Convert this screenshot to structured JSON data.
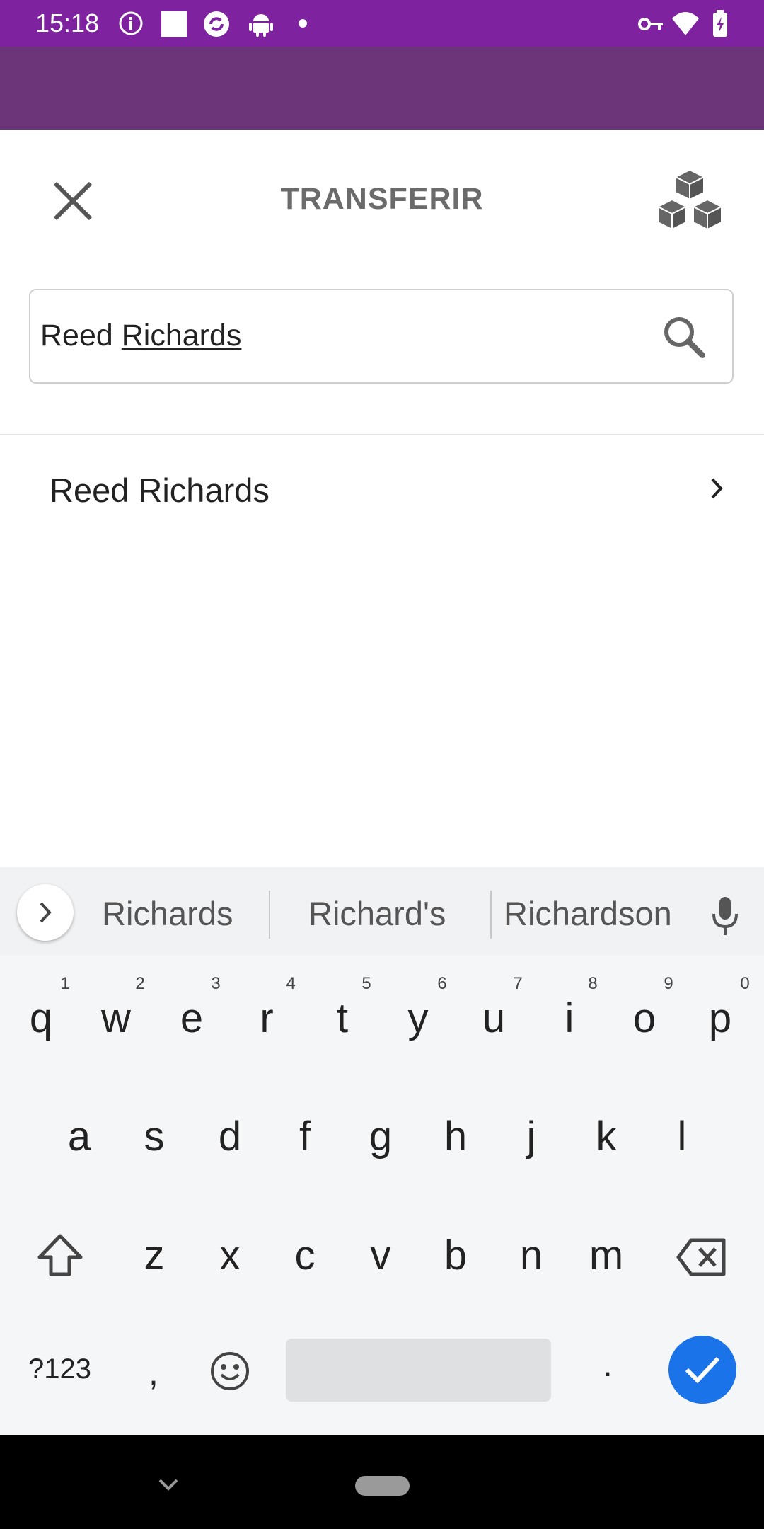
{
  "status_bar": {
    "time": "15:18"
  },
  "header": {
    "title": "TRANSFERIR",
    "close_icon": "close-icon",
    "boxes_icon": "cubes-icon"
  },
  "search": {
    "value_first": "Reed ",
    "value_composing": "Richards",
    "icon": "search-icon"
  },
  "results": [
    {
      "label": "Reed Richards"
    }
  ],
  "suggestions": {
    "items": [
      "Richards",
      "Richard's",
      "Richardson"
    ]
  },
  "keyboard": {
    "row1": [
      "q",
      "w",
      "e",
      "r",
      "t",
      "y",
      "u",
      "i",
      "o",
      "p"
    ],
    "row1_hints": [
      "1",
      "2",
      "3",
      "4",
      "5",
      "6",
      "7",
      "8",
      "9",
      "0"
    ],
    "row2": [
      "a",
      "s",
      "d",
      "f",
      "g",
      "h",
      "j",
      "k",
      "l"
    ],
    "row3": [
      "z",
      "x",
      "c",
      "v",
      "b",
      "n",
      "m"
    ],
    "symbols_key": "?123",
    "comma_key": ",",
    "period_key": "."
  },
  "colors": {
    "status_bar": "#7e22a0",
    "app_bar": "#6c3579",
    "accent": "#1a73e8"
  }
}
